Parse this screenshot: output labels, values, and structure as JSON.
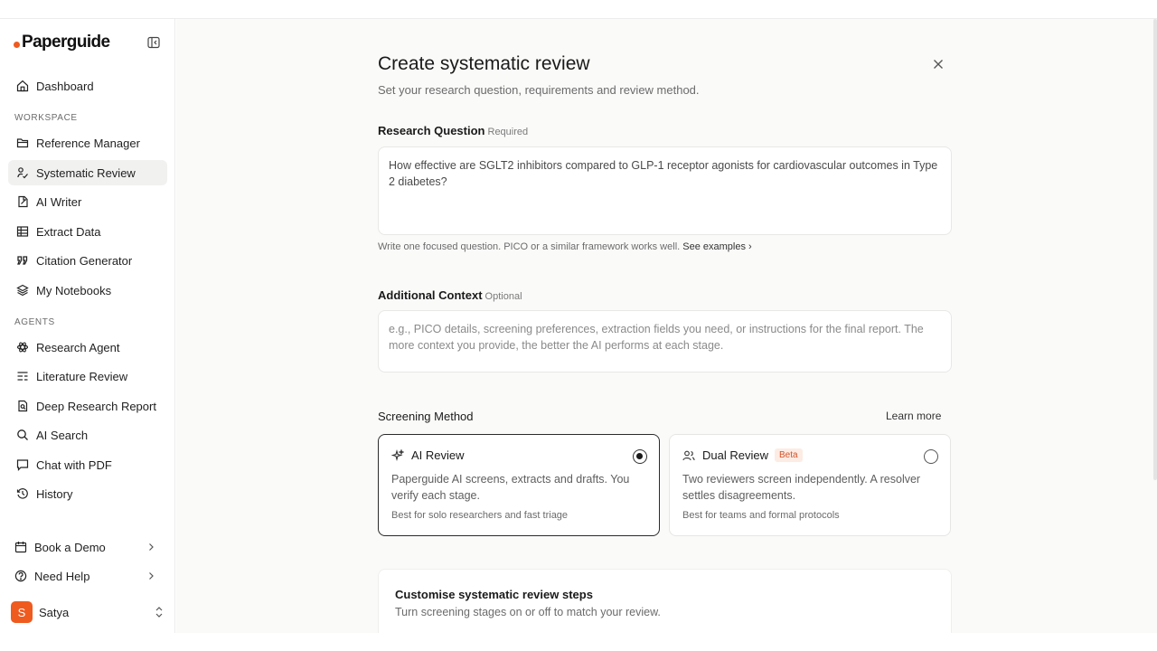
{
  "app": {
    "logo": "Paperguide"
  },
  "sidebar": {
    "dashboard": "Dashboard",
    "workspace_label": "WORKSPACE",
    "workspace": [
      {
        "label": "Reference Manager",
        "icon": "folder-icon"
      },
      {
        "label": "Systematic Review",
        "icon": "review-icon",
        "active": true
      },
      {
        "label": "AI Writer",
        "icon": "ai-writer-icon"
      },
      {
        "label": "Extract Data",
        "icon": "table-icon"
      },
      {
        "label": "Citation Generator",
        "icon": "quote-icon"
      },
      {
        "label": "My Notebooks",
        "icon": "layers-icon"
      }
    ],
    "agents_label": "AGENTS",
    "agents": [
      {
        "label": "Research Agent",
        "icon": "atom-icon"
      },
      {
        "label": "Literature Review",
        "icon": "list-icon"
      },
      {
        "label": "Deep Research Report",
        "icon": "report-icon"
      },
      {
        "label": "AI Search",
        "icon": "search-icon"
      },
      {
        "label": "Chat with PDF",
        "icon": "chat-icon"
      },
      {
        "label": "History",
        "icon": "history-icon"
      }
    ],
    "book_demo": "Book a Demo",
    "need_help": "Need Help",
    "user": {
      "initial": "S",
      "name": "Satya"
    }
  },
  "form": {
    "title": "Create systematic review",
    "subtitle": "Set your research question, requirements and review method.",
    "question": {
      "label": "Research Question",
      "tag": "Required",
      "value": "How effective are SGLT2 inhibitors compared to GLP-1 receptor agonists for cardiovascular outcomes in Type 2 diabetes?",
      "hint": "Write one focused question. PICO or a similar framework works well.",
      "hint_link": "See examples"
    },
    "context": {
      "label": "Additional Context",
      "tag": "Optional",
      "placeholder": "e.g., PICO details, screening preferences, extraction fields you need, or instructions for the final report. The more context you provide, the better the AI performs at each stage."
    },
    "screening": {
      "label": "Screening Method",
      "learn_more": "Learn more",
      "options": [
        {
          "title": "AI Review",
          "desc": "Paperguide AI screens, extracts and drafts. You verify each stage.",
          "note": "Best for solo researchers and fast triage",
          "selected": true
        },
        {
          "title": "Dual Review",
          "badge": "Beta",
          "desc": "Two reviewers screen independently. A resolver settles disagreements.",
          "note": "Best for teams and formal protocols",
          "selected": false
        }
      ]
    },
    "steps": {
      "title": "Customise systematic review steps",
      "subtitle": "Turn screening stages on or off to match your review."
    }
  },
  "colors": {
    "accent": "#ef5a1f",
    "badge_text": "#d1542a",
    "badge_bg": "#fdece4"
  }
}
